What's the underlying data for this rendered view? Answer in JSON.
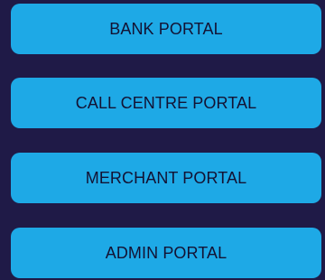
{
  "portals": [
    {
      "label": "BANK PORTAL"
    },
    {
      "label": "CALL CENTRE PORTAL"
    },
    {
      "label": "MERCHANT PORTAL"
    },
    {
      "label": "ADMIN PORTAL"
    }
  ],
  "colors": {
    "background": "#1f1a47",
    "button": "#1ea9e6",
    "button_text": "#131233"
  }
}
